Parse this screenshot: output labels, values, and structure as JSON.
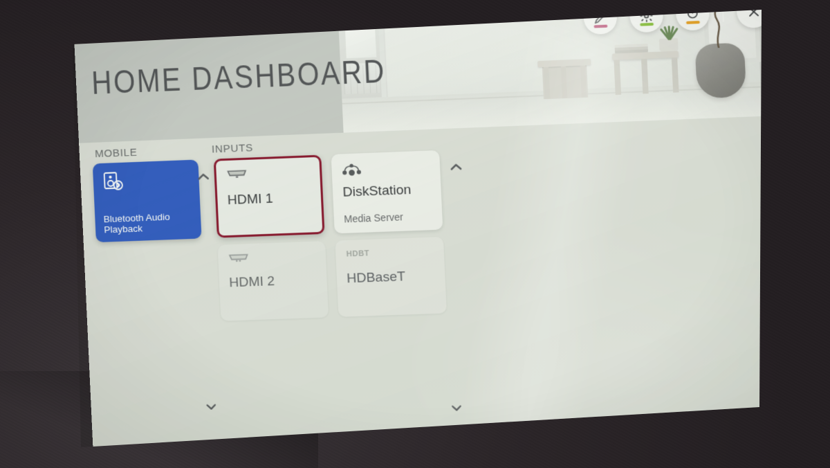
{
  "screen": {
    "title": "HOME DASHBOARD",
    "accent_selected": "#3560c4",
    "accent_focus_border": "#8c1c32",
    "surface": "#dfe2dc",
    "header_band": "#c9ccc8"
  },
  "controls": [
    {
      "name": "edit",
      "icon": "pencil-icon",
      "bar_color": "#c4547e"
    },
    {
      "name": "settings",
      "icon": "gear-icon",
      "bar_color": "#8ec63f"
    },
    {
      "name": "refresh",
      "icon": "refresh-icon",
      "bar_color": "#f0a92a"
    },
    {
      "name": "close",
      "icon": "close-icon",
      "bar_color": ""
    }
  ],
  "columns": {
    "mobile_label": "MOBILE",
    "inputs_label": "INPUTS"
  },
  "mobile_cards": [
    {
      "title": "Bluetooth Audio Playback",
      "subtitle": "",
      "icon": "bluetooth-speaker-icon",
      "state": "selected"
    }
  ],
  "input_cards": [
    {
      "title": "HDMI 1",
      "subtitle": "",
      "icon": "hdmi-port-icon",
      "state": "focused"
    },
    {
      "title": "DiskStation",
      "subtitle": "Media Server",
      "icon": "network-share-icon",
      "state": "connected"
    },
    {
      "title": "HDMI 2",
      "subtitle": "",
      "icon": "hdmi-port-icon",
      "state": "inactive"
    },
    {
      "title": "HDBaseT",
      "subtitle": "",
      "icon": "hdbt-logo-icon",
      "state": "inactive",
      "badge": "HDBT"
    }
  ],
  "scroll": {
    "up_mobile": "▲",
    "up_inputs": "▲",
    "down_mobile": "▼",
    "down_inputs": "▼"
  }
}
